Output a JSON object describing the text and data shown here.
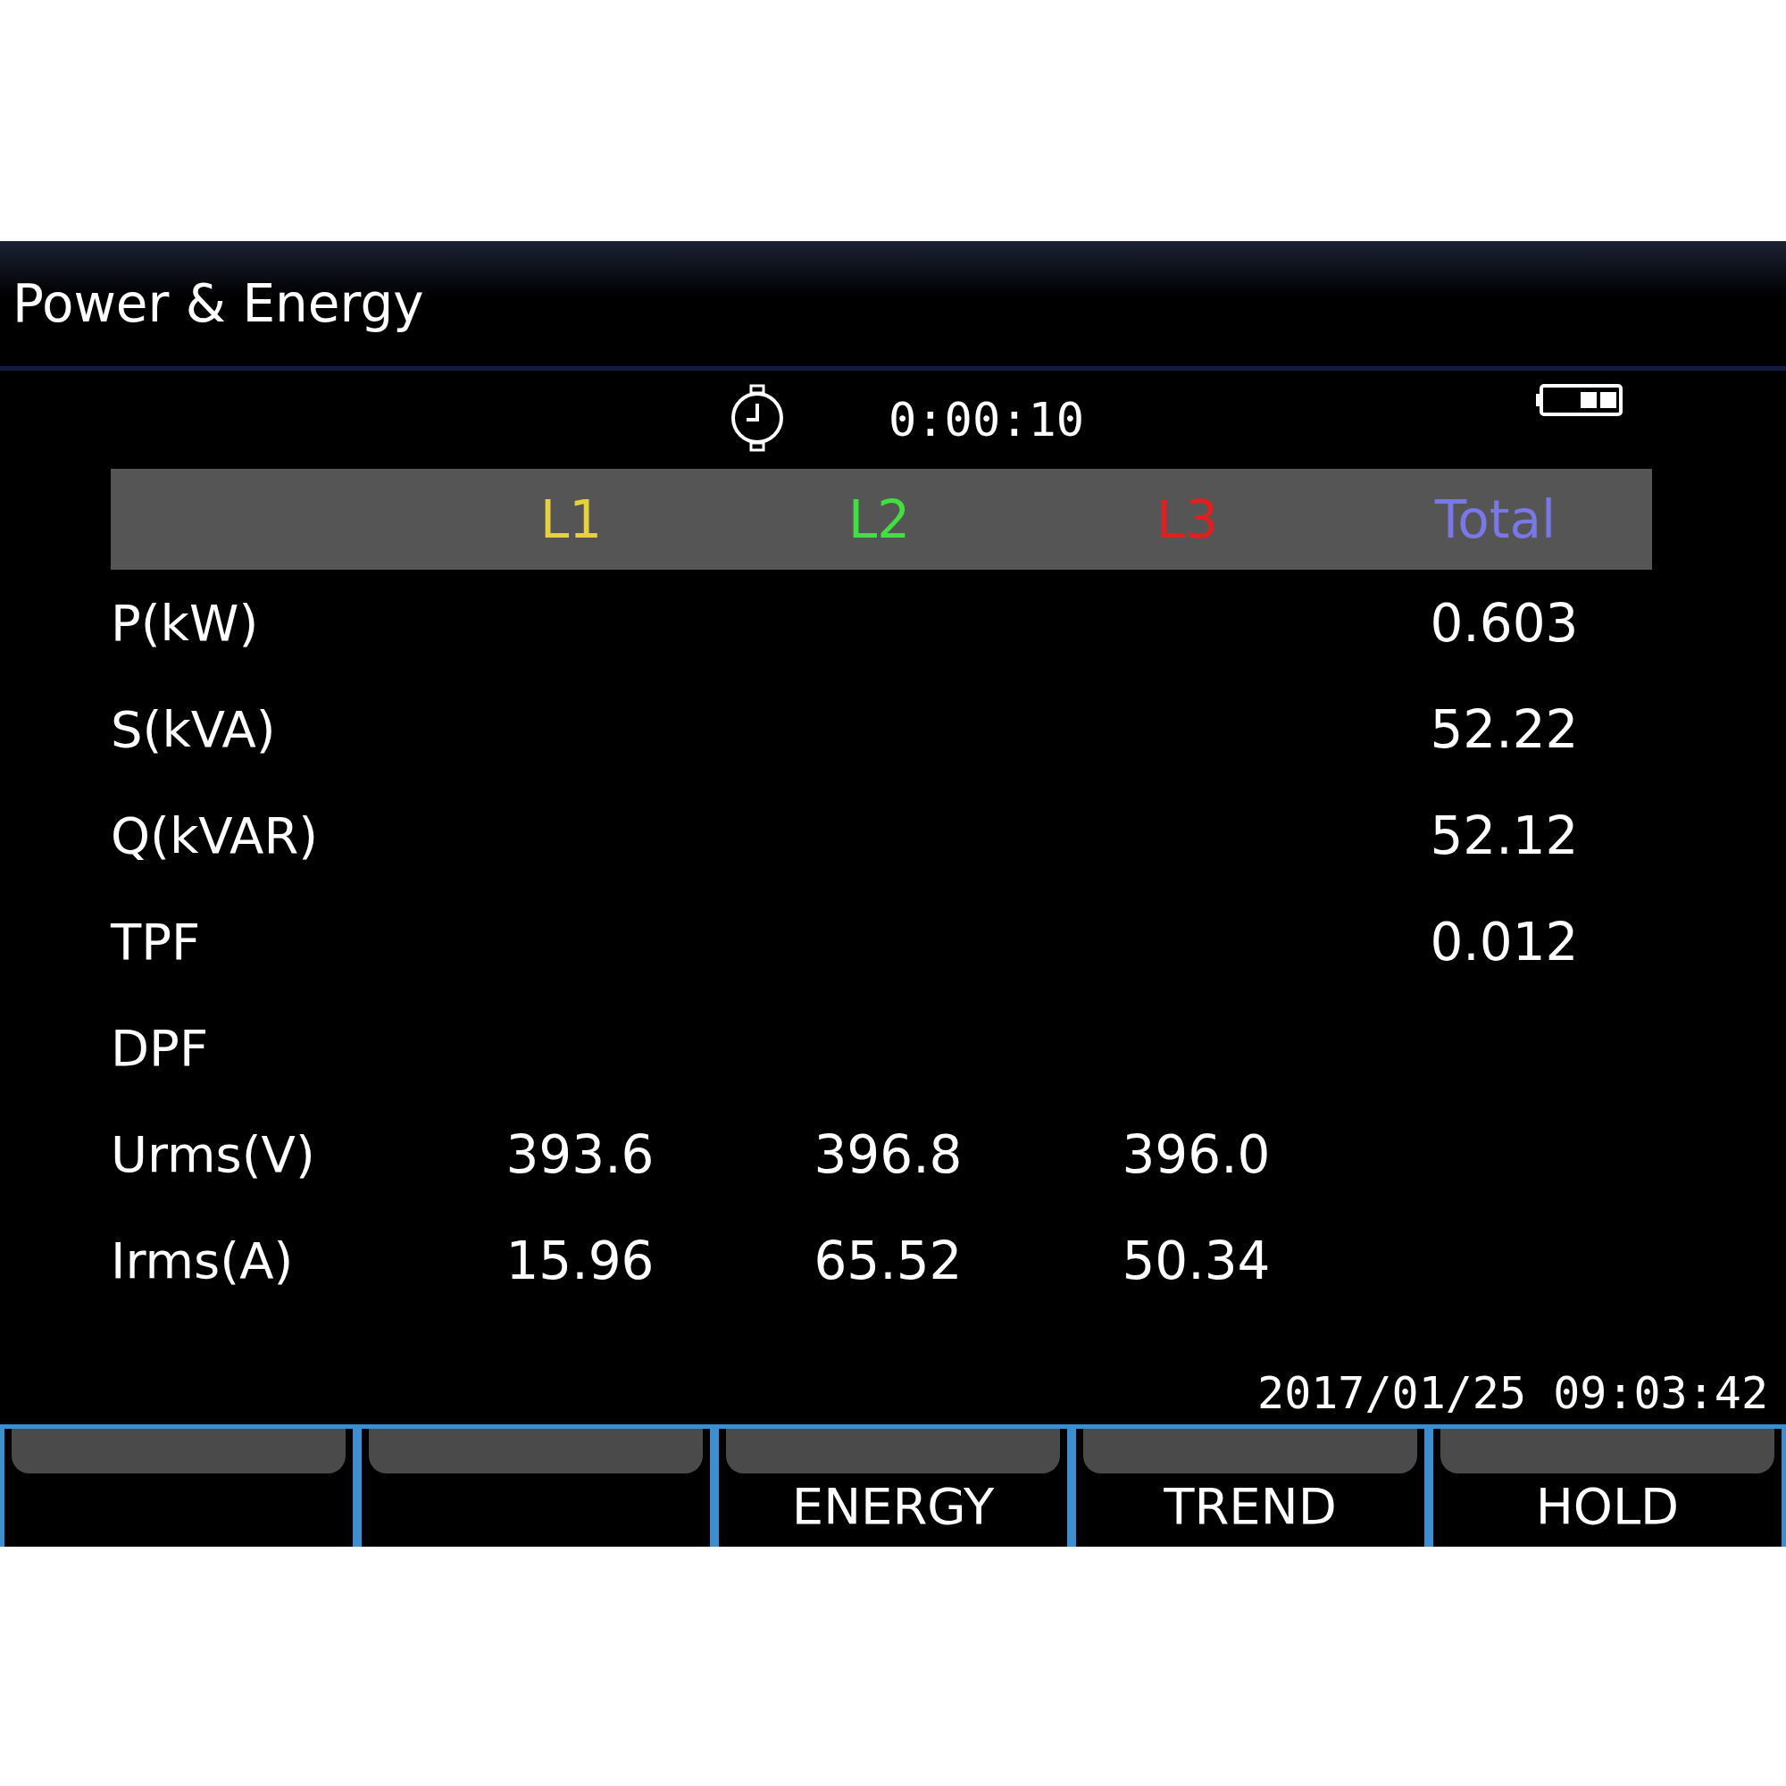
{
  "title": "Power & Energy",
  "status": {
    "elapsed": "0:00:10"
  },
  "columns": [
    {
      "label": "L1",
      "color": "#e6d23a"
    },
    {
      "label": "L2",
      "color": "#3fe03f"
    },
    {
      "label": "L3",
      "color": "#e02020"
    },
    {
      "label": "Total",
      "color": "#7a78e8"
    }
  ],
  "rows": [
    {
      "label": "P(kW)",
      "total": "0.603"
    },
    {
      "label": "S(kVA)",
      "total": "52.22"
    },
    {
      "label": "Q(kVAR)",
      "total": "52.12"
    },
    {
      "label": "TPF",
      "total": "0.012"
    },
    {
      "label": "DPF"
    },
    {
      "label": "Urms(V)",
      "l1": "393.6",
      "l2": "396.8",
      "l3": "396.0"
    },
    {
      "label": "Irms(A)",
      "l1": "15.96",
      "l2": "65.52",
      "l3": "50.34"
    }
  ],
  "datetime": "2017/01/25 09:03:42",
  "softkeys": [
    {
      "kind": "blank"
    },
    {
      "kind": "blank"
    },
    {
      "kind": "labeled",
      "label": "ENERGY"
    },
    {
      "kind": "labeled",
      "label": "TREND"
    },
    {
      "kind": "labeled",
      "label": "HOLD"
    }
  ]
}
